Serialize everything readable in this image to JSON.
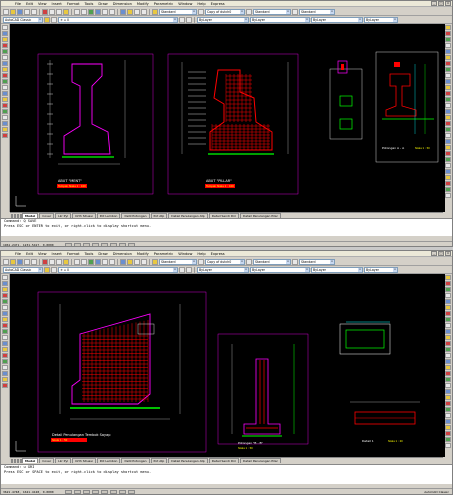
{
  "menus": [
    "File",
    "Edit",
    "View",
    "Insert",
    "Format",
    "Tools",
    "Draw",
    "Dimension",
    "Modify",
    "Parametric",
    "Window",
    "Help",
    "Express"
  ],
  "win1": {
    "workspace": "AutoCAD Classic",
    "layer_combo": "0",
    "linetype_combo": "ByLayer",
    "lineweight_combo": "ByLayer",
    "color_combo": "ByLayer",
    "dim_style": "Copy of dutch0",
    "text_style": "Standard",
    "table_style": "Standard",
    "tabs": [
      "Model",
      "Cover",
      "Lkr Pyl",
      "Orth Situasi",
      "Pot Lembon",
      "Detil Potongan",
      "Pot Atp",
      "Detail Penulangan Atp",
      "Detail Sendi Diri",
      "Detail Penulangan Pilar"
    ],
    "active_tab": "Model",
    "command_lines": [
      "Command: Q SAVE",
      "Press ESC or ENTER to exit, or right-click to display shortcut menu."
    ],
    "coords": "1961.2471, 1231.5417, 0.0000",
    "drawings": {
      "title_a": "ABUT \"MENT\"",
      "sub_a": "Tampak Skala 1 : 100",
      "title_b": "ABUT \"PILLAR\"",
      "sub_b": "Tampak Skala 1 : 100",
      "title_c": "Potongan A - A",
      "sub_c": "Skala 1 : 50"
    }
  },
  "win2": {
    "workspace": "AutoCAD Classic",
    "layer_combo": "0",
    "linetype_combo": "ByLayer",
    "lineweight_combo": "ByLayer",
    "color_combo": "ByLayer",
    "dim_style": "Copy of dutch0",
    "text_style": "Standard",
    "table_style": "Standard",
    "tabs": [
      "Model",
      "Cover",
      "Lkr Pyl",
      "Orth Situasi",
      "Pot Lembon",
      "Detil Potongan",
      "Pot Atp",
      "Detail Penulangan Atp",
      "Detail Sendi Diri",
      "Detail Penulangan Pilar"
    ],
    "active_tab": "Model",
    "command_lines": [
      "Command: u GRI",
      "Press ESC or SPACE to exit, or right-click to display shortcut menu."
    ],
    "coords": "3621.4748, 1621.4128, 0.0000",
    "status_right": "AutoCAD Classic",
    "drawings": {
      "title_a": "Detail Penulangan Tembok Sayap",
      "sub_a": "Skala 1 : 50",
      "title_b": "Potongan \"B - B\"",
      "sub_b": "Skala 1 : 50",
      "title_c": "Detail 1",
      "sub_c": "Skala 1 : 20"
    }
  },
  "colors": {
    "canvas": "#000000",
    "magenta": "#ff00ff",
    "red": "#ff0000",
    "green": "#00ff00",
    "cyan": "#00ffff",
    "yellow": "#ffff00",
    "white": "#ffffff"
  }
}
